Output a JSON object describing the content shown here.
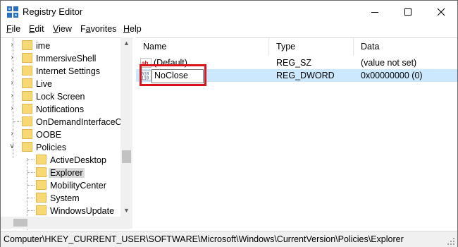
{
  "app": {
    "title": "Registry Editor"
  },
  "menu": {
    "file": {
      "u": "F",
      "rest": "ile"
    },
    "edit": {
      "u": "E",
      "rest": "dit"
    },
    "view": {
      "u": "V",
      "rest": "iew"
    },
    "favorites": {
      "pre": "F",
      "u": "a",
      "rest": "vorites"
    },
    "help": {
      "u": "H",
      "rest": "elp"
    }
  },
  "tree": {
    "items": [
      {
        "label": "ime",
        "expandable": true
      },
      {
        "label": "ImmersiveShell",
        "expandable": true
      },
      {
        "label": "Internet Settings",
        "expandable": true
      },
      {
        "label": "Live",
        "expandable": true
      },
      {
        "label": "Lock Screen",
        "expandable": true
      },
      {
        "label": "Notifications",
        "expandable": true
      },
      {
        "label": "OnDemandInterfaceCa",
        "expandable": false
      },
      {
        "label": "OOBE",
        "expandable": true
      },
      {
        "label": "Policies",
        "expandable": true,
        "expanded": true
      },
      {
        "label": "ActiveDesktop",
        "expandable": false
      },
      {
        "label": "Explorer",
        "expandable": false,
        "selected": true
      },
      {
        "label": "MobilityCenter",
        "expandable": false
      },
      {
        "label": "System",
        "expandable": false
      },
      {
        "label": "WindowsUpdate",
        "expandable": false
      }
    ]
  },
  "list": {
    "columns": {
      "name": "Name",
      "type": "Type",
      "data": "Data"
    },
    "rows": [
      {
        "name": "(Default)",
        "type": "REG_SZ",
        "data": "(value not set)",
        "icon": "string-value-icon"
      },
      {
        "name": "NoClose",
        "type": "REG_DWORD",
        "data": "0x00000000 (0)",
        "icon": "binary-value-icon",
        "editing": true
      }
    ]
  },
  "status": {
    "path": "Computer\\HKEY_CURRENT_USER\\SOFTWARE\\Microsoft\\Windows\\CurrentVersion\\Policies\\Explorer"
  },
  "colors": {
    "selection": "#cce8ff",
    "highlight_box": "#d9141d",
    "folder": "#f8d775"
  }
}
